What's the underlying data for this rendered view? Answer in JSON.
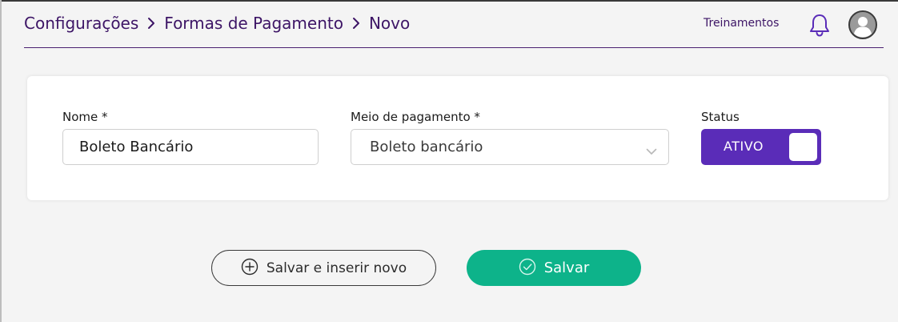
{
  "breadcrumb": {
    "items": [
      "Configurações",
      "Formas de Pagamento",
      "Novo"
    ]
  },
  "header": {
    "link_label": "Treinamentos",
    "bell_icon": "bell-icon",
    "avatar_icon": "user-avatar-icon"
  },
  "form": {
    "name": {
      "label": "Nome *",
      "value": "Boleto Bancário"
    },
    "payment_method": {
      "label": "Meio de pagamento *",
      "selected": "Boleto bancário"
    },
    "status": {
      "label": "Status",
      "toggle_label": "ATIVO",
      "on": true
    }
  },
  "actions": {
    "save_and_new_label": "Salvar e inserir novo",
    "save_label": "Salvar"
  },
  "colors": {
    "brand_purple": "#3d1566",
    "toggle_purple": "#5a2cb8",
    "save_green": "#0db38a",
    "background": "#f4f4f4"
  }
}
